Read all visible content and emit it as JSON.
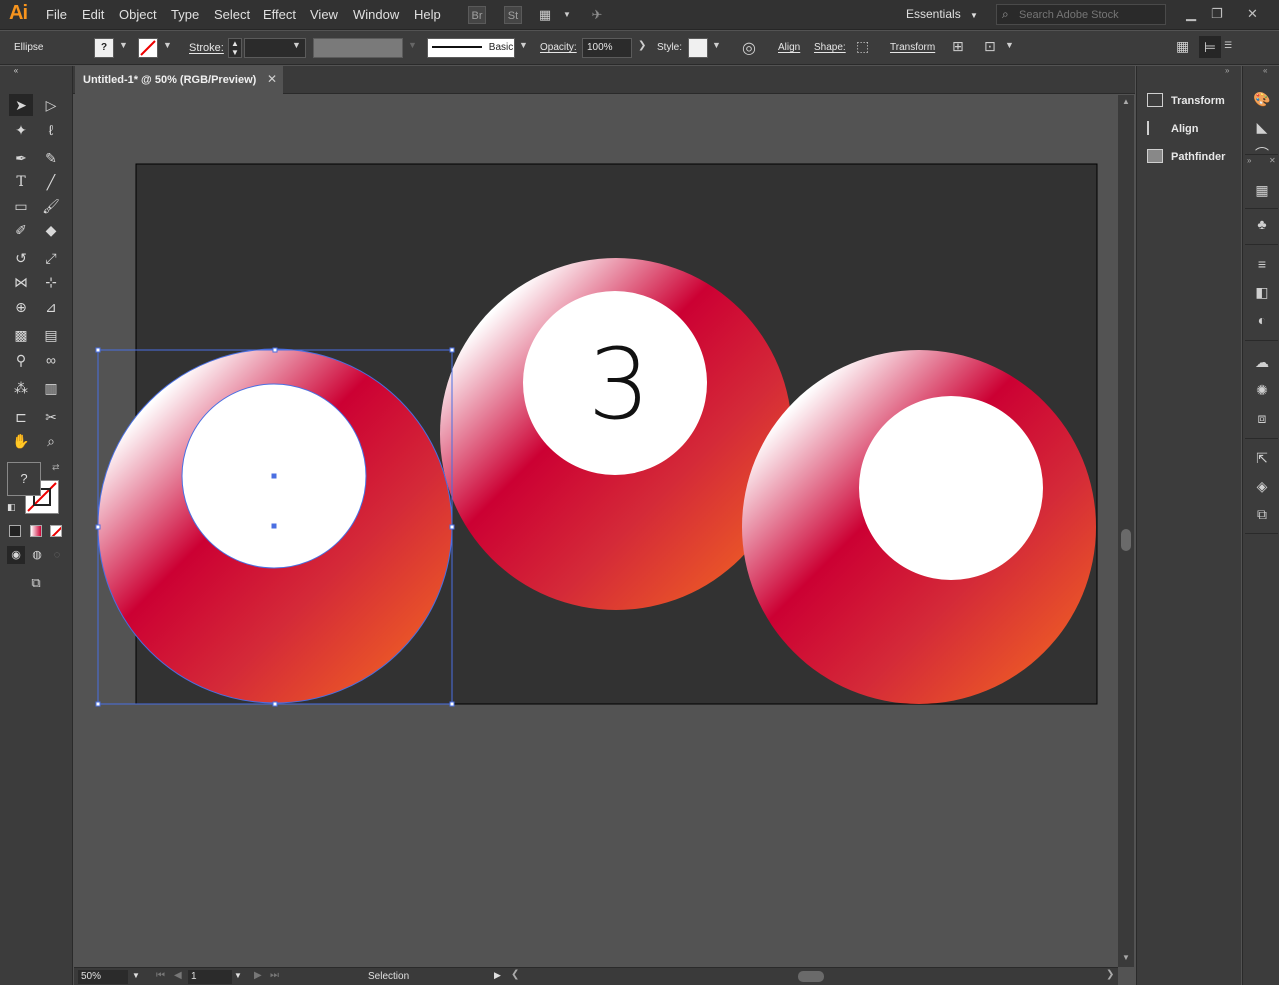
{
  "app": {
    "logo": "Ai"
  },
  "menu": [
    "File",
    "Edit",
    "Object",
    "Type",
    "Select",
    "Effect",
    "View",
    "Window",
    "Help"
  ],
  "topbar": {
    "bridge": "Br",
    "stock": "St",
    "workspace": "Essentials",
    "search_placeholder": "Search Adobe Stock"
  },
  "control": {
    "object_type": "Ellipse",
    "fill_unknown": "?",
    "stroke_label": "Stroke:",
    "brush": "Basic",
    "opacity_label": "Opacity:",
    "opacity_value": "100%",
    "style_label": "Style:",
    "align": "Align",
    "shape": "Shape:",
    "transform": "Transform"
  },
  "document": {
    "tab": "Untitled-1* @ 50% (RGB/Preview)"
  },
  "canvas": {
    "artboard_color": "#323232",
    "ball_gradient": [
      "#ffffff",
      "#cc0033",
      "#d42a38",
      "#f26522"
    ],
    "ball_number": "3"
  },
  "status": {
    "zoom": "50%",
    "page": "1",
    "tool": "Selection"
  },
  "panels": [
    "Transform",
    "Align",
    "Pathfinder"
  ],
  "colors": {
    "selection": "#4a6fe2",
    "accent": "#f7941d"
  }
}
